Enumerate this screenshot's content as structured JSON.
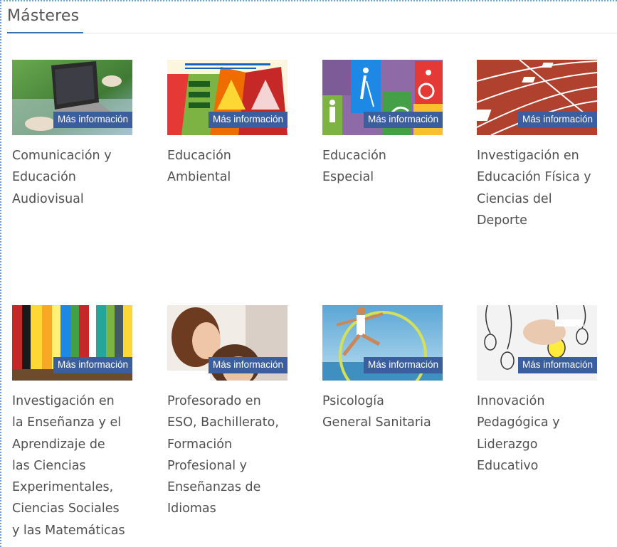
{
  "section": {
    "title": "Másteres"
  },
  "badge_label": "Más información",
  "colors": {
    "accent": "#3c6fae",
    "badge_bg": "#3b5f9e",
    "frame_dotted": "#6a9fd8"
  },
  "masters": [
    {
      "title": "Comunicación y\nEducación\nAudiovisual",
      "image": "laptop-on-grass-photo"
    },
    {
      "title": "Educación\nAmbiental",
      "image": "ema-logo-image"
    },
    {
      "title": "Educación\nEspecial",
      "image": "accessibility-puzzle-image"
    },
    {
      "title": "Investigación en\nEducación Física y\nCiencias del\nDeporte",
      "image": "running-track-photo"
    },
    {
      "title": "Investigación en\nla Enseñanza y el\nAprendizaje de\nlas Ciencias\nExperimentales,\nCiencias Sociales\ny las Matemáticas",
      "image": "bookshelf-photo"
    },
    {
      "title": "Profesorado en\nESO, Bachillerato,\nFormación\nProfesional y\nEnseñanzas de\nIdiomas",
      "image": "teacher-student-photo"
    },
    {
      "title": "Psicología\nGeneral Sanitaria",
      "image": "runner-sky-photo"
    },
    {
      "title": "Innovación\nPedagógica y\nLiderazgo\nEducativo",
      "image": "lightbulbs-sketch-image"
    }
  ]
}
